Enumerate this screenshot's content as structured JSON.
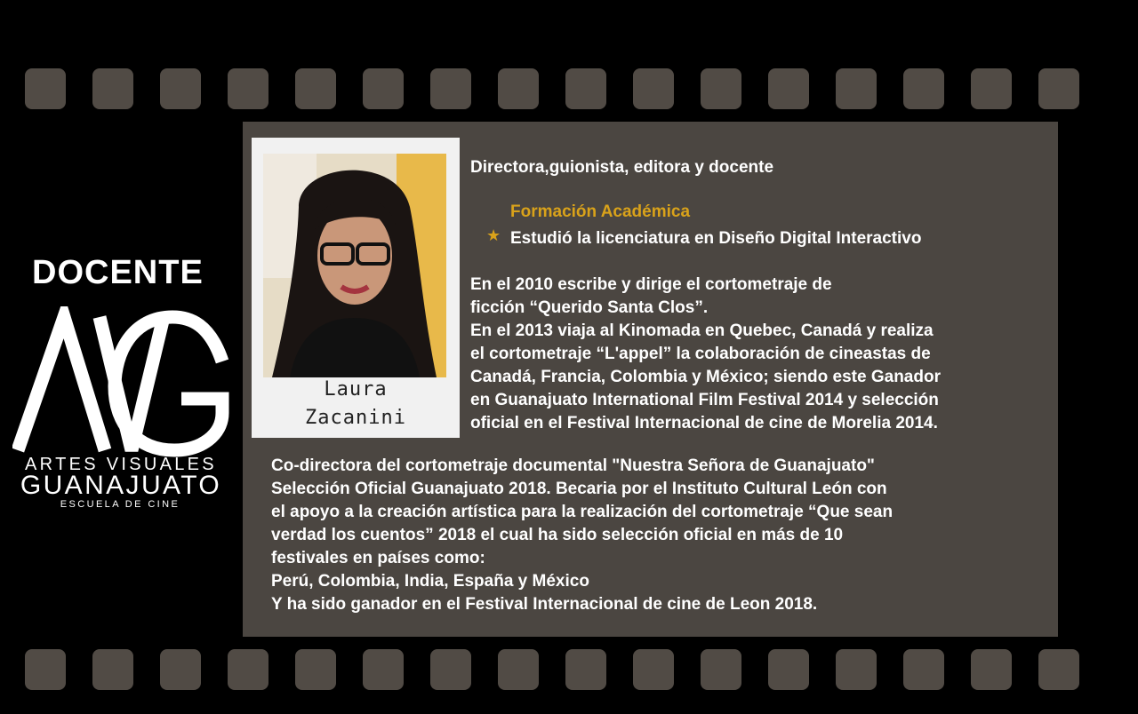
{
  "sidebar": {
    "label": "DOCENTE",
    "logo": {
      "mark": "AVG",
      "line1": "ARTES VISUALES",
      "line2": "GUANAJUATO",
      "line3": "ESCUELA DE CINE"
    }
  },
  "profile": {
    "caption_line1": "Laura",
    "caption_line2": "Zacanini",
    "title": "Directora,guionista, editora y docente",
    "section_heading": "Formación Académica",
    "bullet": "Estudió la licenciatura en Diseño Digital Interactivo",
    "bio_lines": [
      "En el 2010 escribe y dirige el cortometraje de",
      "ficción “Querido Santa Clos”.",
      "En el 2013 viaja al Kinomada en Quebec, Canadá y realiza",
      "el cortometraje “L'appel” la colaboración de cineastas de",
      "Canadá, Francia, Colombia y México; siendo este Ganador",
      "en  Guanajuato International Film Festival 2014 y selección",
      "oficial en el Festival Internacional de cine de Morelia 2014."
    ],
    "bio2_lines": [
      "Co-directora del cortometraje documental \"Nuestra Señora de Guanajuato\"",
      "Selección Oficial Guanajuato 2018. Becaria por el Instituto Cultural León con",
      "el apoyo a la creación artística para la realización del cortometraje “Que sean",
      "verdad los cuentos” 2018 el cual ha sido selección oficial en más de 10",
      "festivales en países como:",
      "Perú, Colombia, India, España y México",
      "Y ha sido ganador en el Festival Internacional de cine de Leon 2018."
    ]
  },
  "colors": {
    "background": "#000000",
    "panel": "#4b4641",
    "sprocket": "#514b45",
    "accent": "#d9a21a"
  }
}
